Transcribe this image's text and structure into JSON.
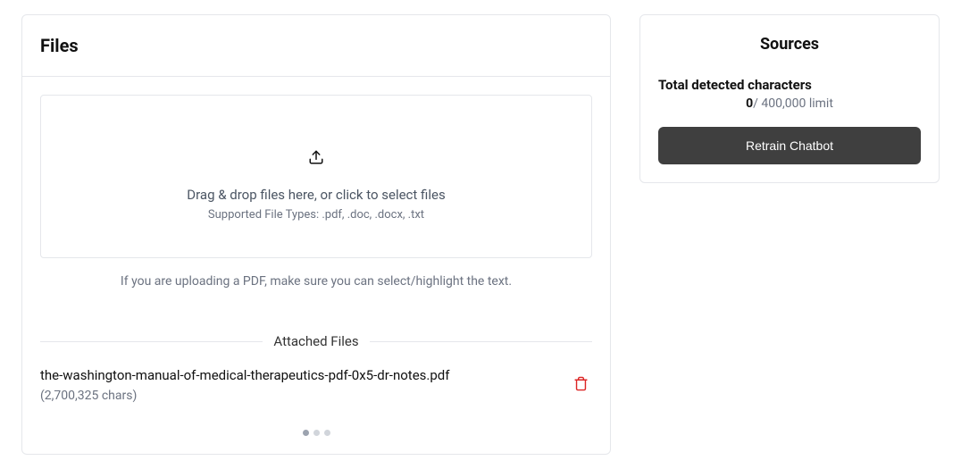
{
  "files": {
    "title": "Files",
    "dropzone": {
      "text": "Drag & drop files here, or click to select files",
      "subtext": "Supported File Types: .pdf, .doc, .docx, .txt"
    },
    "pdf_note": "If you are uploading a PDF, make sure you can select/highlight the text.",
    "attached_label": "Attached Files",
    "attached": [
      {
        "name": "the-washington-manual-of-medical-therapeutics-pdf-0x5-dr-notes.pdf",
        "chars": "(2,700,325 chars)"
      }
    ]
  },
  "sources": {
    "title": "Sources",
    "total_label": "Total detected characters",
    "total_value": "0",
    "total_limit": "/ 400,000 limit",
    "retrain_label": "Retrain Chatbot"
  }
}
